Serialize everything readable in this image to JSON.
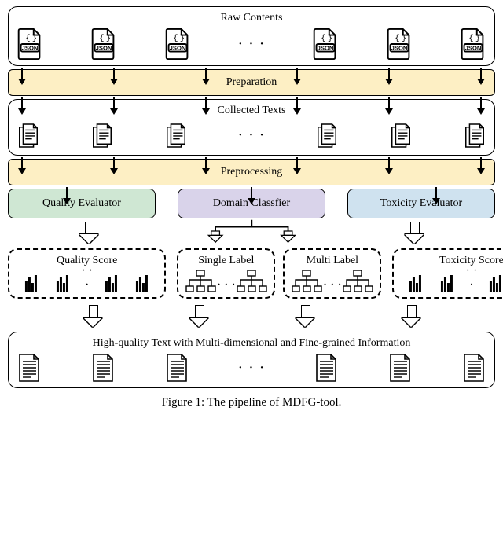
{
  "stages": {
    "raw_contents": "Raw Contents",
    "preparation": "Preparation",
    "collected_texts": "Collected Texts",
    "preprocessing": "Preprocessing"
  },
  "evaluators": {
    "quality": "Quality Evaluator",
    "domain": "Domain Classfier",
    "toxicity": "Toxicity Evaluator"
  },
  "results": {
    "quality_score": "Quality Score",
    "single_label": "Single Label",
    "multi_label": "Multi Label",
    "toxicity_score": "Toxicity Score"
  },
  "output": "High-quality Text with Multi-dimensional and Fine-grained Information",
  "caption": "Figure 1: The pipeline of MDFG-tool.",
  "glyphs": {
    "ellipsis": "· · ·",
    "json_label": "JSON"
  }
}
